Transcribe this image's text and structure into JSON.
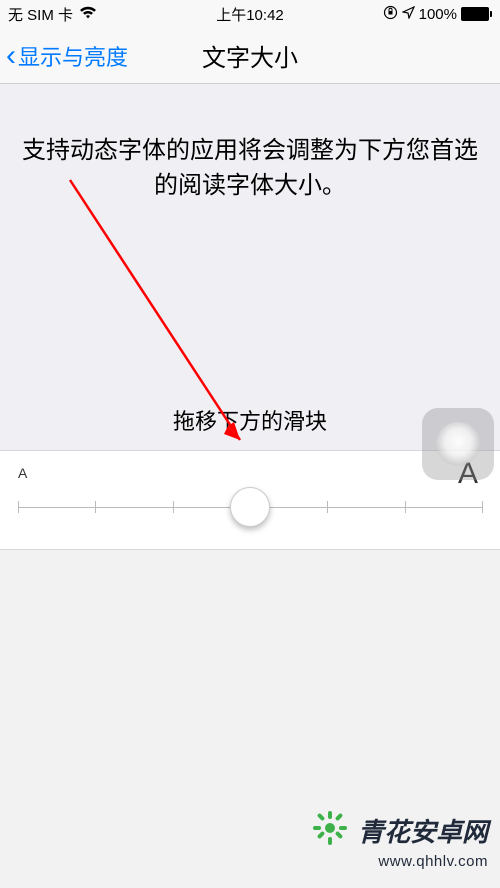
{
  "status": {
    "carrier": "无 SIM 卡",
    "time": "上午10:42",
    "battery_pct": "100%"
  },
  "nav": {
    "back_label": "显示与亮度",
    "title": "文字大小"
  },
  "description": "支持动态字体的应用将会调整为下方您首选的阅读字体大小。",
  "slider": {
    "hint": "拖移下方的滑块",
    "small_letter": "A",
    "large_letter": "A",
    "steps": 7,
    "current_step": 3
  },
  "watermark": {
    "name": "青花安卓网",
    "url": "www.qhhlv.com"
  }
}
